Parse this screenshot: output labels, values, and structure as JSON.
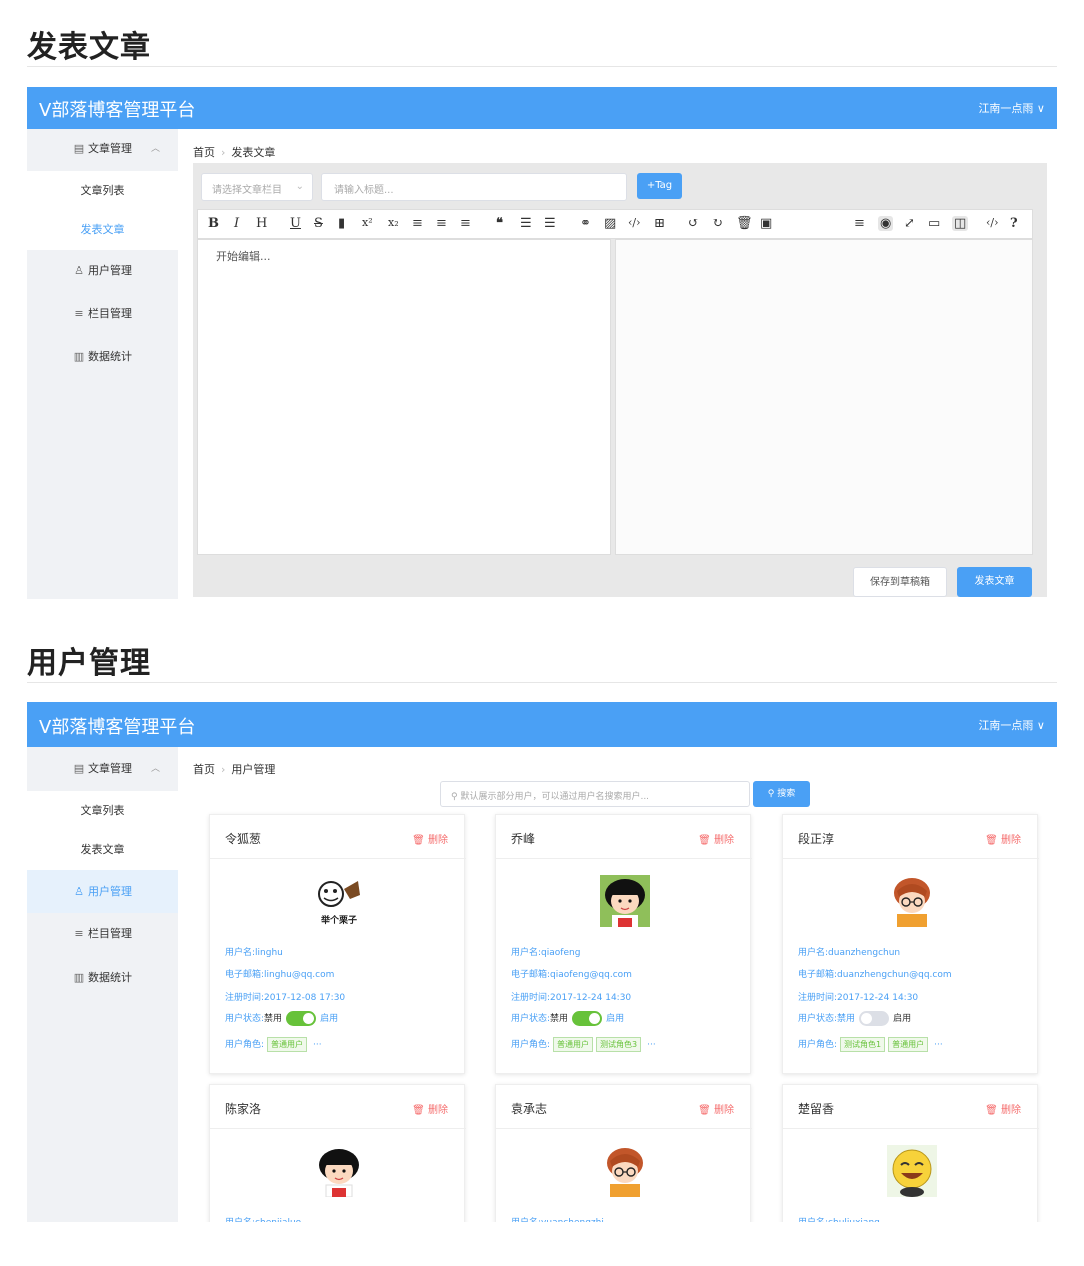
{
  "section1": {
    "title": "发表文章"
  },
  "section2": {
    "title": "用户管理"
  },
  "app": {
    "brand": "V部落博客管理平台",
    "user": "江南一点雨 ∨"
  },
  "sidebar": {
    "article_mgmt": "文章管理",
    "article_list": "文章列表",
    "post_article": "发表文章",
    "user_mgmt": "用户管理",
    "column_mgmt": "栏目管理",
    "stats": "数据统计"
  },
  "breadcrumb": {
    "home": "首页",
    "article": "发表文章",
    "users": "用户管理"
  },
  "editor": {
    "category_placeholder": "请选择文章栏目",
    "title_placeholder": "请输入标题...",
    "tag_button": "+Tag",
    "content_placeholder": "开始编辑...",
    "save_draft": "保存到草稿箱",
    "publish": "发表文章"
  },
  "user_page": {
    "search_placeholder": "默认展示部分用户，可以通过用户名搜索用户...",
    "search_button": "搜索",
    "delete_label": "删除",
    "labels": {
      "username": "用户名:",
      "email": "电子邮箱:",
      "regtime": "注册时间:",
      "status": "用户状态:",
      "disabled": "禁用",
      "enabled": "启用",
      "role": "用户角色:",
      "more": "···"
    },
    "users": [
      {
        "nickname": "令狐葱",
        "username": "linghu",
        "email": "linghu@qq.com",
        "regtime": "2017-12-08 17:30",
        "enabled": true,
        "roles": [
          "普通用户"
        ],
        "avatar_caption": "举个栗子"
      },
      {
        "nickname": "乔峰",
        "username": "qiaofeng",
        "email": "qiaofeng@qq.com",
        "regtime": "2017-12-24 14:30",
        "enabled": true,
        "roles": [
          "普通用户",
          "测试角色3"
        ]
      },
      {
        "nickname": "段正淳",
        "username": "duanzhengchun",
        "email": "duanzhengchun@qq.com",
        "regtime": "2017-12-24 14:30",
        "enabled": false,
        "roles": [
          "测试角色1",
          "普通用户"
        ]
      },
      {
        "nickname": "陈家洛",
        "username": "chenjialuo"
      },
      {
        "nickname": "袁承志",
        "username": "yuanchengzhi"
      },
      {
        "nickname": "楚留香",
        "username": "chuliuxiang"
      }
    ]
  },
  "colors": {
    "primary": "#4aa0f5",
    "danger": "#f56c6c",
    "success": "#67c23a",
    "switch_off": "#dcdfe6"
  }
}
